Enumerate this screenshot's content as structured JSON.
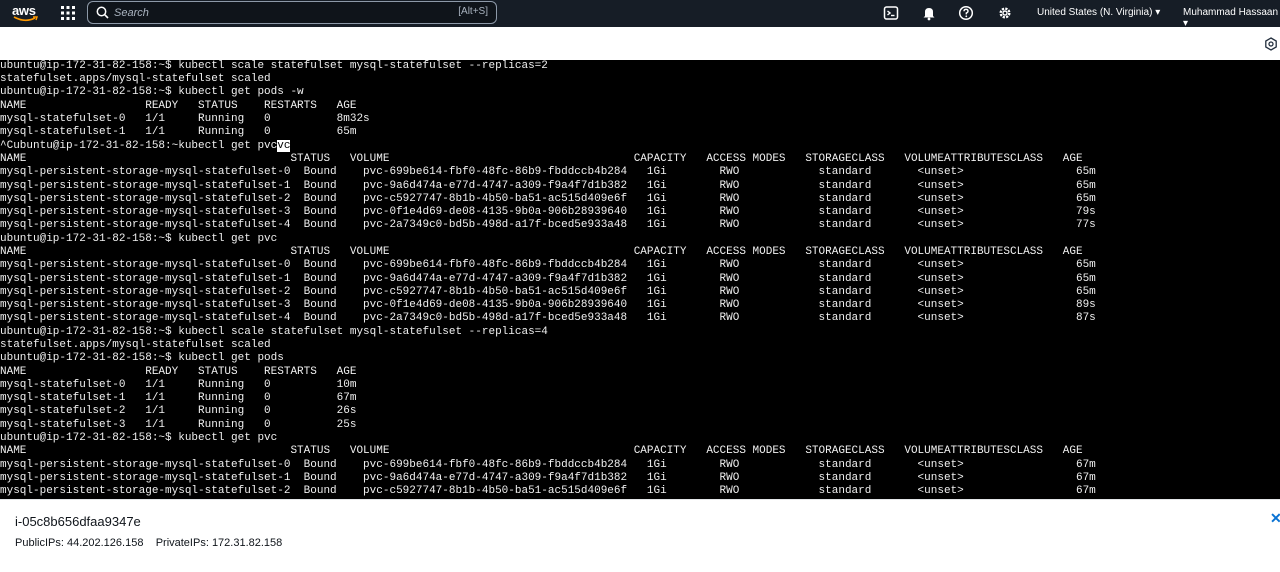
{
  "nav": {
    "logo": "aws",
    "search_placeholder": "Search",
    "search_shortcut": "[Alt+S]",
    "region": "United States (N. Virginia) ▾",
    "user": "Muhammad Hassaan ▾",
    "icons": [
      "apps-grid-icon",
      "search-icon",
      "cloudshell-icon",
      "bell-icon",
      "help-icon",
      "gear-icon"
    ]
  },
  "terminal": {
    "lines": [
      "ubuntu@ip-172-31-82-158:~$ kubectl scale statefulset mysql-statefulset --replicas=2",
      "statefulset.apps/mysql-statefulset scaled",
      "ubuntu@ip-172-31-82-158:~$ kubectl get pods -w",
      "NAME                  READY   STATUS    RESTARTS   AGE",
      "mysql-statefulset-0   1/1     Running   0          8m32s",
      "mysql-statefulset-1   1/1     Running   0          65m",
      "^Cubuntu@ip-172-31-82-158:~kubectl get pvc",
      "NAME                                        STATUS   VOLUME                                     CAPACITY   ACCESS MODES   STORAGECLASS   VOLUMEATTRIBUTESCLASS   AGE",
      "mysql-persistent-storage-mysql-statefulset-0  Bound    pvc-699be614-fbf0-48fc-86b9-fbddccb4b284   1Gi        RWO            standard       <unset>                 65m",
      "mysql-persistent-storage-mysql-statefulset-1  Bound    pvc-9a6d474a-e77d-4747-a309-f9a4f7d1b382   1Gi        RWO            standard       <unset>                 65m",
      "mysql-persistent-storage-mysql-statefulset-2  Bound    pvc-c5927747-8b1b-4b50-ba51-ac515d409e6f   1Gi        RWO            standard       <unset>                 65m",
      "mysql-persistent-storage-mysql-statefulset-3  Bound    pvc-0f1e4d69-de08-4135-9b0a-906b28939640   1Gi        RWO            standard       <unset>                 79s",
      "mysql-persistent-storage-mysql-statefulset-4  Bound    pvc-2a7349c0-bd5b-498d-a17f-bced5e933a48   1Gi        RWO            standard       <unset>                 77s",
      "ubuntu@ip-172-31-82-158:~$ kubectl get pvc",
      "NAME                                        STATUS   VOLUME                                     CAPACITY   ACCESS MODES   STORAGECLASS   VOLUMEATTRIBUTESCLASS   AGE",
      "mysql-persistent-storage-mysql-statefulset-0  Bound    pvc-699be614-fbf0-48fc-86b9-fbddccb4b284   1Gi        RWO            standard       <unset>                 65m",
      "mysql-persistent-storage-mysql-statefulset-1  Bound    pvc-9a6d474a-e77d-4747-a309-f9a4f7d1b382   1Gi        RWO            standard       <unset>                 65m",
      "mysql-persistent-storage-mysql-statefulset-2  Bound    pvc-c5927747-8b1b-4b50-ba51-ac515d409e6f   1Gi        RWO            standard       <unset>                 65m",
      "mysql-persistent-storage-mysql-statefulset-3  Bound    pvc-0f1e4d69-de08-4135-9b0a-906b28939640   1Gi        RWO            standard       <unset>                 89s",
      "mysql-persistent-storage-mysql-statefulset-4  Bound    pvc-2a7349c0-bd5b-498d-a17f-bced5e933a48   1Gi        RWO            standard       <unset>                 87s",
      "ubuntu@ip-172-31-82-158:~$ kubectl scale statefulset mysql-statefulset --replicas=4",
      "statefulset.apps/mysql-statefulset scaled",
      "ubuntu@ip-172-31-82-158:~$ kubectl get pods",
      "NAME                  READY   STATUS    RESTARTS   AGE",
      "mysql-statefulset-0   1/1     Running   0          10m",
      "mysql-statefulset-1   1/1     Running   0          67m",
      "mysql-statefulset-2   1/1     Running   0          26s",
      "mysql-statefulset-3   1/1     Running   0          25s",
      "ubuntu@ip-172-31-82-158:~$ kubectl get pvc",
      "NAME                                        STATUS   VOLUME                                     CAPACITY   ACCESS MODES   STORAGECLASS   VOLUMEATTRIBUTESCLASS   AGE",
      "mysql-persistent-storage-mysql-statefulset-0  Bound    pvc-699be614-fbf0-48fc-86b9-fbddccb4b284   1Gi        RWO            standard       <unset>                 67m",
      "mysql-persistent-storage-mysql-statefulset-1  Bound    pvc-9a6d474a-e77d-4747-a309-f9a4f7d1b382   1Gi        RWO            standard       <unset>                 67m",
      "mysql-persistent-storage-mysql-statefulset-2  Bound    pvc-c5927747-8b1b-4b50-ba51-ac515d409e6f   1Gi        RWO            standard       <unset>                 67m"
    ],
    "highlighted": "vc"
  },
  "instance": {
    "id": "i-05c8b656dfaa9347e",
    "public_label": "PublicIPs:",
    "public_ip": "44.202.126.158",
    "private_label": "PrivateIPs:",
    "private_ip": "172.31.82.158"
  },
  "colors": {
    "nav_bg": "#161d26",
    "terminal_bg": "#000000",
    "terminal_fg": "#f0f0f0",
    "link": "#0972d3"
  }
}
